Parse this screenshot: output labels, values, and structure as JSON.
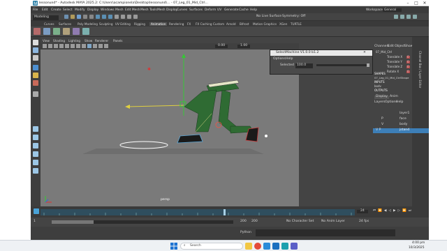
{
  "window": {
    "title": "lessonund* - Autodesk MAYA 2025.2: C:\\Users\\acampionela\\Desktop\\lessonund\\... - 07_Leg_01_Mid_Ctrl...",
    "controls": [
      "–",
      "□",
      "✕"
    ]
  },
  "menubar": {
    "items": [
      "File",
      "Edit",
      "Create",
      "Select",
      "Modify",
      "Display",
      "Windows",
      "Mesh",
      "Edit Mesh",
      "Mesh Tools",
      "Mesh Display",
      "Curves",
      "Surfaces",
      "Deform",
      "UV",
      "Generate",
      "Cache",
      "Help"
    ],
    "workspace_label": "Workspace:",
    "workspace_value": "General"
  },
  "statusline": {
    "mode": "Modeling",
    "no_live": "No Live Surface",
    "symmetry": "Symmetry: Off"
  },
  "shelf": {
    "tabs": [
      "Curves",
      "Surfaces",
      "Poly Modeling",
      "Sculpting",
      "UV Editing",
      "Rigging",
      "Animation",
      "Rendering",
      "FX",
      "FX Caching",
      "Custom",
      "Arnold",
      "Bifrost",
      "Motion Graphics",
      "XGen",
      "TURTLE"
    ]
  },
  "viewport": {
    "menus": [
      "View",
      "Shading",
      "Lighting",
      "Show",
      "Renderer",
      "Panels"
    ],
    "camera_label": "persp",
    "field1": "0.00",
    "field2": "1.00"
  },
  "dialog": {
    "title": "SelectMachine V1.0.0 b1.2",
    "menus": [
      "Options",
      "Help"
    ],
    "row_label": "Selected",
    "row_value": "100.0"
  },
  "channelbox": {
    "menus": [
      "Channels",
      "Edit",
      "Object",
      "Show"
    ],
    "node_name": "07_Mid_Ctrl",
    "attrs": [
      {
        "name": "Translate X",
        "value": "0"
      },
      {
        "name": "Translate Y",
        "value": "0"
      },
      {
        "name": "Translate Z",
        "value": "0"
      },
      {
        "name": "Rotate X",
        "value": "0"
      }
    ],
    "shapes_label": "SHAPES",
    "shape_name": "07_Leg_01_Mid_CtrlShape",
    "inputs_label": "INPUTS",
    "input_name": "bodv",
    "outputs_label": "OUTPUTS",
    "side_tab": "Channel Box / Layer Editor"
  },
  "layers": {
    "tabs": [
      "Display",
      "Anim"
    ],
    "menus": [
      "Layers",
      "Options",
      "Help"
    ],
    "rows": [
      {
        "label": "layer1",
        "flags": ""
      },
      {
        "label": "face",
        "flags": "P"
      },
      {
        "label": "body",
        "flags": "V"
      },
      {
        "label": "jstand",
        "flags": "V  P"
      }
    ]
  },
  "timeslider": {
    "current_frame": "24",
    "fps": "24 fps"
  },
  "rangebar": {
    "start": "1",
    "range_end": "200",
    "end": "200",
    "char_set": "No Character Set",
    "anim_layer": "No Anim Layer"
  },
  "cmdline": {
    "lang": "Python"
  },
  "taskbar": {
    "search_placeholder": "Search",
    "time": "4:00 pm",
    "date": "10/3/2025"
  },
  "colors": {
    "accent_blue": "#5ba8d8",
    "pants_green": "#2f6b33",
    "viewport_grey": "#7a7a7a",
    "timeline_blue": "#2f4e5e",
    "highlight": "#3d7fb8"
  }
}
